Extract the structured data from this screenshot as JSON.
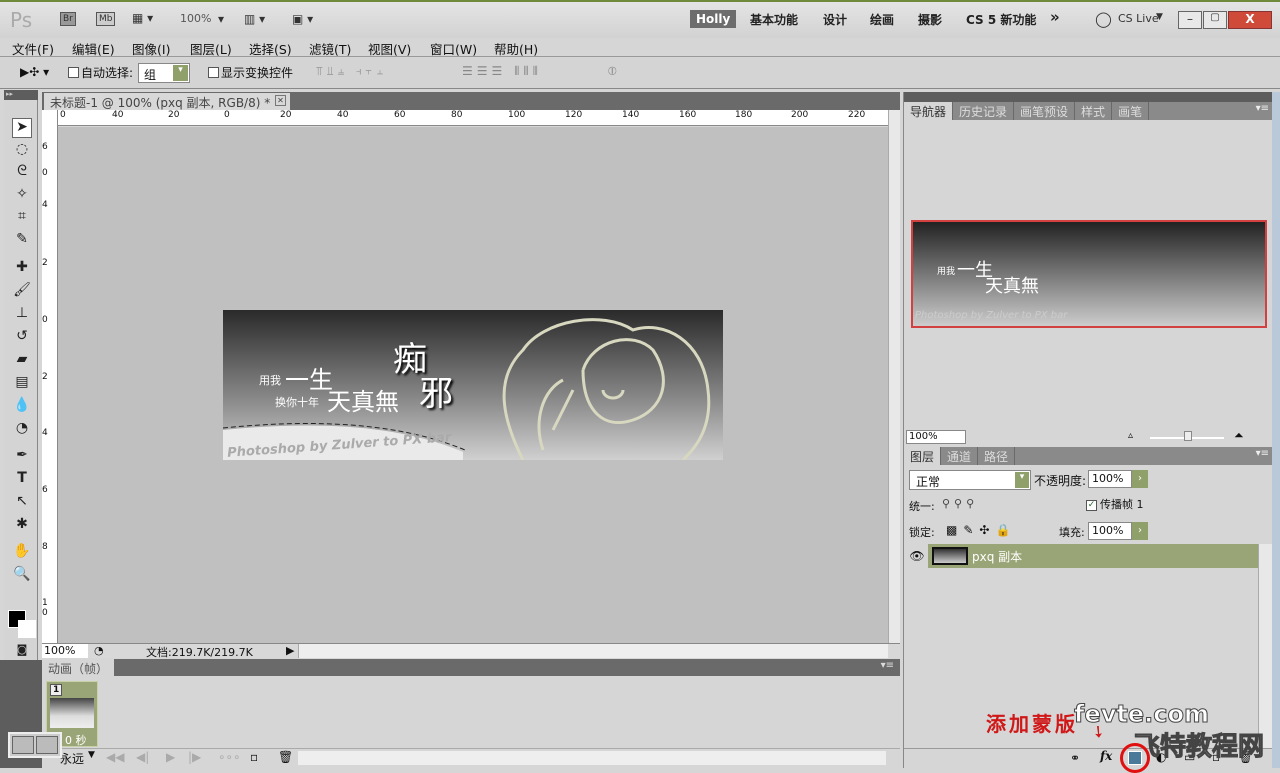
{
  "app": {
    "logo": "Ps",
    "bridge": "Br",
    "minibridge": "Mb",
    "zoom": "100%",
    "workspaces": [
      "Holly",
      "基本功能",
      "设计",
      "绘画",
      "摄影",
      "CS 5 新功能"
    ],
    "more": "»",
    "cslive": "CS Live"
  },
  "menu": [
    "文件(F)",
    "编辑(E)",
    "图像(I)",
    "图层(L)",
    "选择(S)",
    "滤镜(T)",
    "视图(V)",
    "窗口(W)",
    "帮助(H)"
  ],
  "options": {
    "auto_select_label": "自动选择:",
    "auto_select_value": "组",
    "show_transform_label": "显示变换控件"
  },
  "document": {
    "tab_title": "未标题-1 @ 100% (pxq 副本, RGB/8) *",
    "ruler_top": [
      "0",
      "40",
      "20",
      "0",
      "20",
      "40",
      "60",
      "80",
      "100",
      "120",
      "140",
      "160",
      "180",
      "200",
      "220"
    ],
    "ruler_left": [
      "6",
      "0",
      "4",
      "2",
      "0",
      "2",
      "4",
      "6",
      "8",
      "1 0",
      "1 2"
    ]
  },
  "image": {
    "line1_small": "用我",
    "line1_big": "一生",
    "line2_small": "换你十年",
    "line2_big": "天真無",
    "title_big": "邪",
    "title_top": "痴",
    "footer": "Photoshop by Zulver to PX bar"
  },
  "status": {
    "zoom": "100%",
    "doc": "文档:219.7K/219.7K"
  },
  "animation": {
    "tab": "动画（帧）",
    "frame_number": "1",
    "frame_delay": "0 秒",
    "loop": "永远"
  },
  "navigator": {
    "tabs": [
      "导航器",
      "历史记录",
      "画笔预设",
      "样式",
      "画笔"
    ],
    "zoom": "100%"
  },
  "layers": {
    "tabs": [
      "图层",
      "通道",
      "路径"
    ],
    "blend_mode": "正常",
    "opacity_label": "不透明度:",
    "opacity": "100%",
    "unify_label": "统一:",
    "propagate_label": "传播帧 1",
    "lock_label": "锁定:",
    "fill_label": "填充:",
    "fill": "100%",
    "items": [
      {
        "name": "pxq 副本",
        "visible": true,
        "selected": true
      }
    ]
  },
  "annotation": {
    "text": "添加蒙版",
    "watermark1": "fevte.com",
    "watermark2": "飞特教程网",
    "color": "#d01818"
  },
  "colors": {
    "accent": "#8fa06a",
    "selected_layer": "#9aa577"
  }
}
